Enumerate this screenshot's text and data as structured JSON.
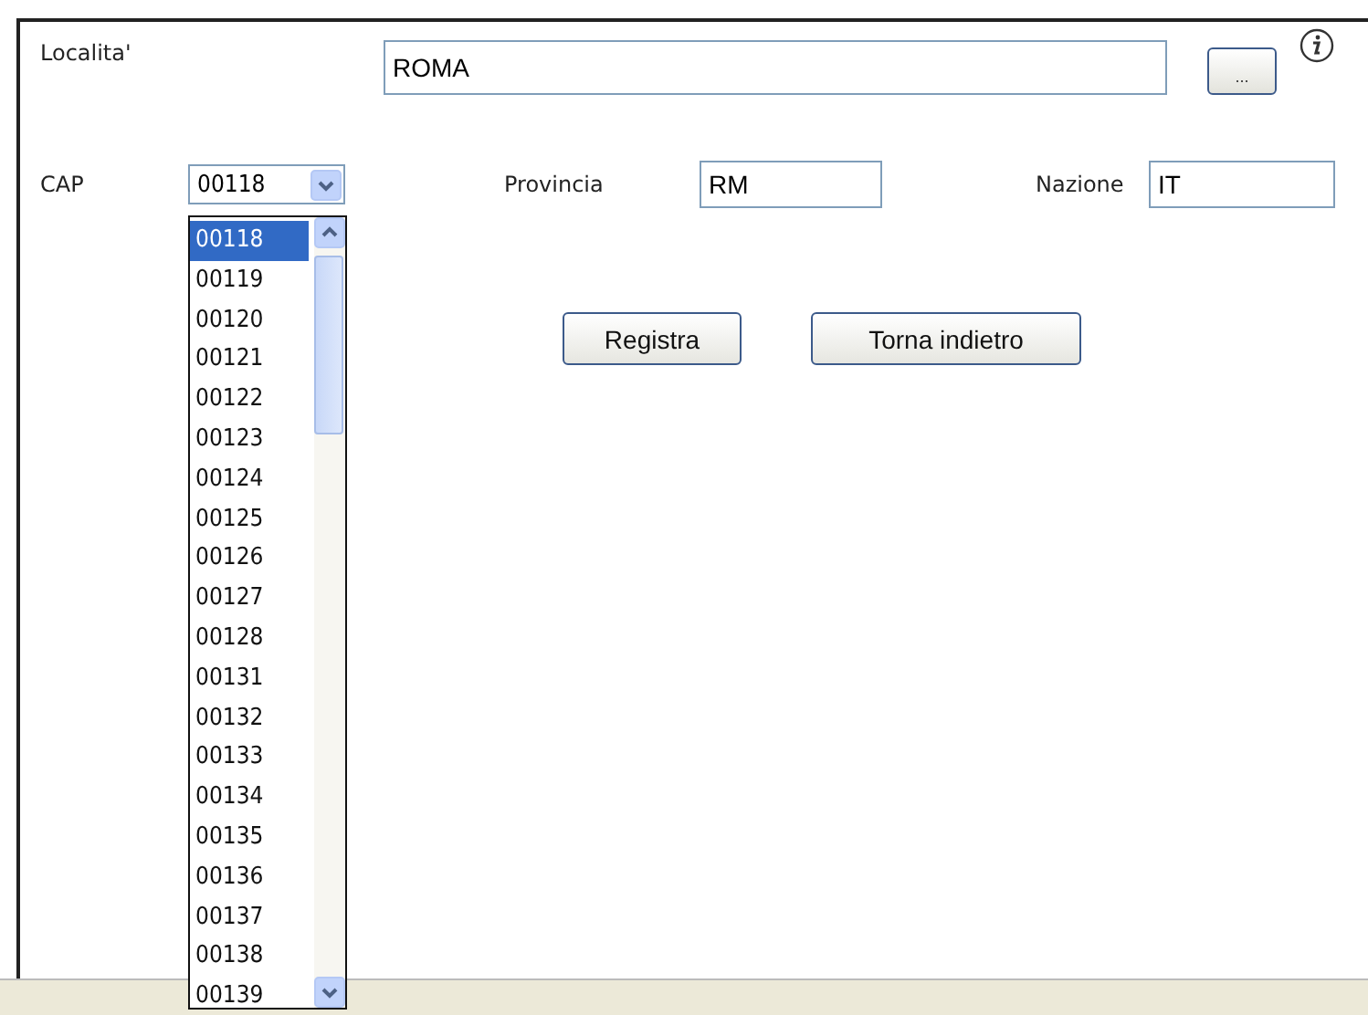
{
  "localita": {
    "label": "Localita'",
    "value": "ROMA",
    "browse_button": "..."
  },
  "cap": {
    "label": "CAP",
    "value": "00118",
    "expanded": true,
    "options": [
      {
        "label": "00118",
        "selected": true
      },
      {
        "label": "00119",
        "selected": false
      },
      {
        "label": "00120",
        "selected": false
      },
      {
        "label": "00121",
        "selected": false
      },
      {
        "label": "00122",
        "selected": false
      },
      {
        "label": "00123",
        "selected": false
      },
      {
        "label": "00124",
        "selected": false
      },
      {
        "label": "00125",
        "selected": false
      },
      {
        "label": "00126",
        "selected": false
      },
      {
        "label": "00127",
        "selected": false
      },
      {
        "label": "00128",
        "selected": false
      },
      {
        "label": "00131",
        "selected": false
      },
      {
        "label": "00132",
        "selected": false
      },
      {
        "label": "00133",
        "selected": false
      },
      {
        "label": "00134",
        "selected": false
      },
      {
        "label": "00135",
        "selected": false
      },
      {
        "label": "00136",
        "selected": false
      },
      {
        "label": "00137",
        "selected": false
      },
      {
        "label": "00138",
        "selected": false
      },
      {
        "label": "00139",
        "selected": false
      }
    ]
  },
  "provincia": {
    "label": "Provincia",
    "value": "RM"
  },
  "nazione": {
    "label": "Nazione",
    "value": "IT"
  },
  "buttons": [
    "Registra",
    "Torna indietro"
  ]
}
